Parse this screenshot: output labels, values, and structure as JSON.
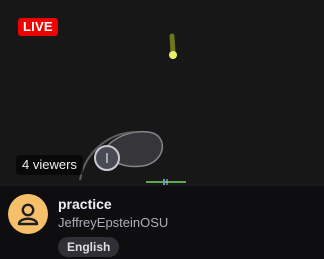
{
  "stream": {
    "live_label": "LIVE",
    "viewers": "4 viewers",
    "title": "practice",
    "channel": "JeffreyEpsteinOSU",
    "tags": [
      "English"
    ]
  },
  "icons": {
    "avatar": "user-icon"
  },
  "colors": {
    "live": "#eb0400",
    "avatar_bg": "#f6c06a",
    "tag_bg": "#2f2f35"
  }
}
